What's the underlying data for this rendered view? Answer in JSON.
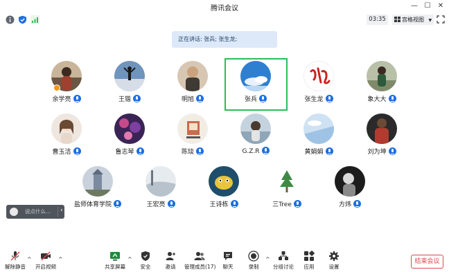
{
  "window": {
    "title": "腾讯会议"
  },
  "status": {
    "timer": "03:35",
    "view_mode": "宫格视图"
  },
  "banner": {
    "text": "正在讲话: 张兵; 张生龙;"
  },
  "participants": [
    {
      "name": "余学亮",
      "avatar_color": "#6a5744",
      "host": true
    },
    {
      "name": "王锴",
      "avatar_color": "#5a7ea8"
    },
    {
      "name": "明旭",
      "avatar_color": "#b9a08a"
    },
    {
      "name": "张兵",
      "avatar_color": "#2f7fd0",
      "active": true
    },
    {
      "name": "张生龙",
      "avatar_color": "#ffffff"
    },
    {
      "name": "象大大",
      "avatar_color": "#7f8a6b"
    },
    {
      "name": "曹玉洁",
      "avatar_color": "#d8c2b2"
    },
    {
      "name": "鲁志琴",
      "avatar_color": "#3a2456"
    },
    {
      "name": "陈琰",
      "avatar_color": "#f2ece3"
    },
    {
      "name": "G.Z.R",
      "avatar_color": "#8fa6b8"
    },
    {
      "name": "黄娟娟",
      "avatar_color": "#9fc3e4"
    },
    {
      "name": "刘为坤",
      "avatar_color": "#b33a2e"
    },
    {
      "name": "盐师体育学院",
      "avatar_color": "#7c8aa0"
    },
    {
      "name": "王宏亮",
      "avatar_color": "#b7c2cc"
    },
    {
      "name": "王诗栋",
      "avatar_color": "#1f4e6b"
    },
    {
      "name": "三Tree",
      "avatar_color": "#ffffff"
    },
    {
      "name": "方炜",
      "avatar_color": "#222222"
    }
  ],
  "chat": {
    "placeholder": "说点什么..."
  },
  "toolbar": {
    "unmute": "解除静音",
    "start_video": "开启视频",
    "share_screen": "共享屏幕",
    "security": "安全",
    "invite": "邀请",
    "manage_members": "管理成员(17)",
    "chat": "聊天",
    "record": "录制",
    "breakout": "分组讨论",
    "apps": "应用",
    "settings": "设置",
    "end_meeting": "结束会议"
  },
  "colors": {
    "accent": "#1e6fe4",
    "active_frame": "#2bbd5b",
    "danger": "#e0474b",
    "signal": "#2bbd5b"
  }
}
